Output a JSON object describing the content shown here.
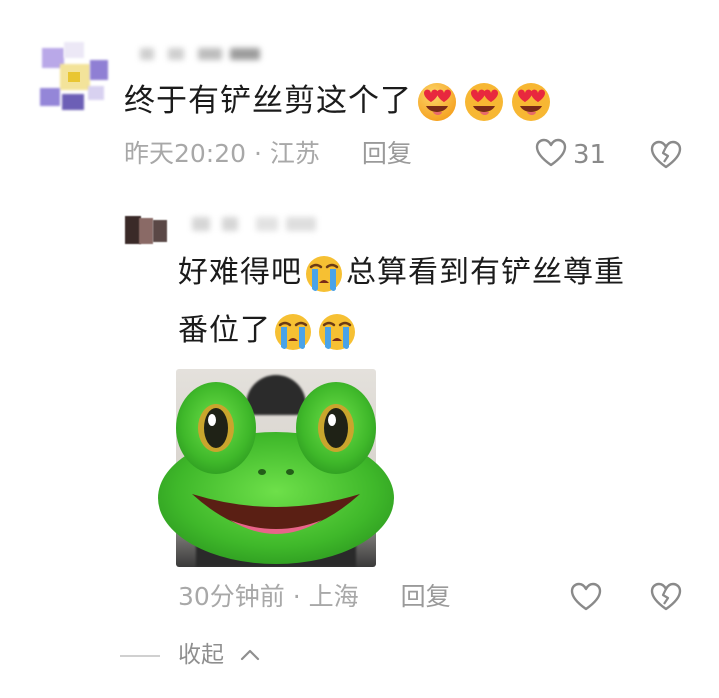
{
  "comment": {
    "text": "终于有铲丝剪这个了",
    "emojis": [
      "heart-eyes-emoji",
      "heart-eyes-emoji",
      "heart-eyes-emoji"
    ],
    "time_location": "昨天20:20 · 江苏",
    "reply_label": "回复",
    "like_count": "31"
  },
  "reply": {
    "line1_part1": "好难得吧",
    "line1_part2": "总算看到有铲丝尊重",
    "line2": "番位了",
    "emojis": [
      "loudly-crying-emoji",
      "loudly-crying-emoji",
      "loudly-crying-emoji"
    ],
    "time_location": "30分钟前 · 上海",
    "reply_label": "回复"
  },
  "collapse": {
    "label": "收起"
  },
  "colors": {
    "text": "#1b1b1b",
    "meta": "#a8a8a8",
    "icon": "#8a8a8a"
  }
}
